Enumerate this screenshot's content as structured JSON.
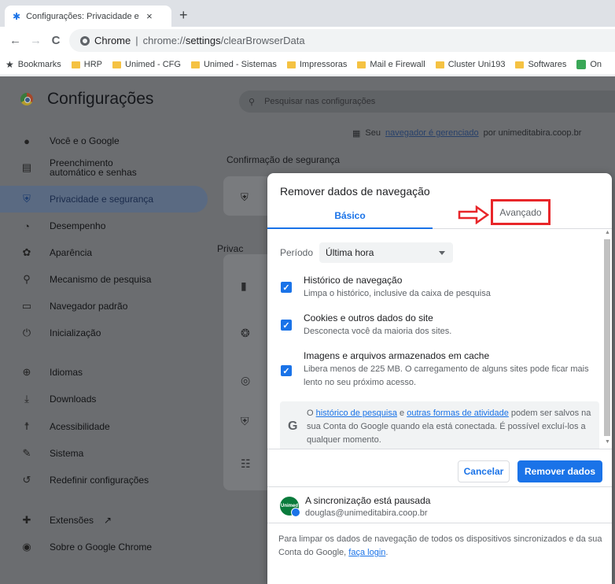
{
  "tab": {
    "title": "Configurações: Privacidade e seg",
    "close": "×",
    "new": "+"
  },
  "toolbar": {
    "back": "←",
    "forward": "→",
    "reload": "C",
    "site_label": "Chrome",
    "separator": "|",
    "url_prefix": "chrome://",
    "url_bold": "settings",
    "url_rest": "/clearBrowserData"
  },
  "bookmarks": {
    "star": "★",
    "items": [
      "Bookmarks",
      "HRP",
      "Unimed - CFG",
      "Unimed - Sistemas",
      "Impressoras",
      "Mail e Firewall",
      "Cluster Uni193",
      "Softwares",
      "On"
    ]
  },
  "settings": {
    "title": "Configurações",
    "search_placeholder": "Pesquisar nas configurações",
    "nav": [
      {
        "label": "Você e o Google",
        "icon": "person-icon"
      },
      {
        "label": "Preenchimento automático e senhas",
        "icon": "clipboard-icon"
      },
      {
        "label": "Privacidade e segurança",
        "icon": "shield-icon"
      },
      {
        "label": "Desempenho",
        "icon": "speedometer-icon"
      },
      {
        "label": "Aparência",
        "icon": "palette-icon"
      },
      {
        "label": "Mecanismo de pesquisa",
        "icon": "search-icon"
      },
      {
        "label": "Navegador padrão",
        "icon": "browser-icon"
      },
      {
        "label": "Inicialização",
        "icon": "power-icon"
      },
      {
        "label": "Idiomas",
        "icon": "globe-icon"
      },
      {
        "label": "Downloads",
        "icon": "download-icon"
      },
      {
        "label": "Acessibilidade",
        "icon": "accessibility-icon"
      },
      {
        "label": "Sistema",
        "icon": "wrench-icon"
      },
      {
        "label": "Redefinir configurações",
        "icon": "reset-icon"
      },
      {
        "label": "Extensões",
        "icon": "puzzle-icon",
        "external": "↗"
      },
      {
        "label": "Sobre o Google Chrome",
        "icon": "chrome-icon"
      }
    ],
    "managed_prefix": "Seu",
    "managed_link": "navegador é gerenciado",
    "managed_suffix": "por unimeditabira.coop.br",
    "section_title": "Confirmação de segurança",
    "privacy_partial": "Privac"
  },
  "dialog": {
    "title": "Remover dados de navegação",
    "tab_basic": "Básico",
    "tab_advanced": "Avançado",
    "period_label": "Período",
    "period_value": "Última hora",
    "items": [
      {
        "title": "Histórico de navegação",
        "desc": "Limpa o histórico, inclusive da caixa de pesquisa",
        "checked": true
      },
      {
        "title": "Cookies e outros dados do site",
        "desc": "Desconecta você da maioria dos sites.",
        "checked": true
      },
      {
        "title": "Imagens e arquivos armazenados em cache",
        "desc": "Libera menos de 225 MB. O carregamento de alguns sites pode ficar mais lento no seu próximo acesso.",
        "checked": true
      }
    ],
    "google_note": {
      "pre": "O ",
      "link1": "histórico de pesquisa",
      "mid": " e ",
      "link2": "outras formas de atividade",
      "post": " podem ser salvos na sua Conta do Google quando ela está conectada. É possível excluí-los a qualquer momento."
    },
    "cancel": "Cancelar",
    "remove": "Remover dados",
    "sync_status": "A sincronização está pausada",
    "sync_email": "douglas@unimeditabira.coop.br",
    "avatar_text": "Unimed",
    "footer_pre": "Para limpar os dados de navegação de todos os dispositivos sincronizados e da sua Conta do Google, ",
    "footer_link": "faça login",
    "footer_post": "."
  },
  "colors": {
    "accent": "#1a73e8",
    "highlight": "#e8262a",
    "overlay": "#6b6d70"
  }
}
